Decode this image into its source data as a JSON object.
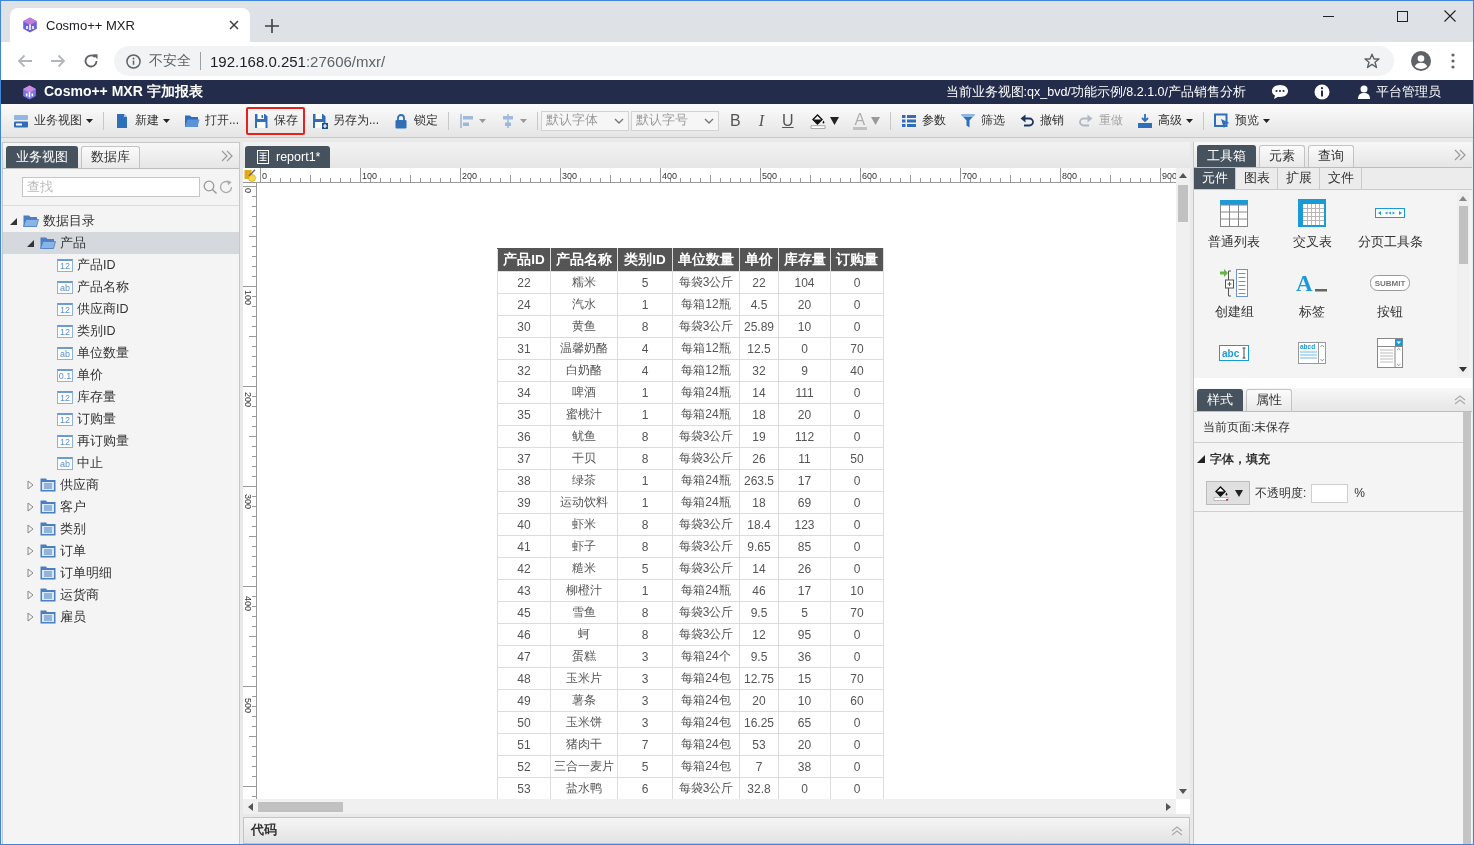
{
  "browser": {
    "tab_title": "Cosmo++ MXR",
    "security_label": "不安全",
    "url_host": "192.168.0.251",
    "url_path": ":27606/mxr/"
  },
  "app_header": {
    "title": "Cosmo++ MXR 宇加报表",
    "current_view": "当前业务视图:qx_bvd/功能示例/8.2.1.0/产品销售分析",
    "user": "平台管理员"
  },
  "toolbar": [
    {
      "kind": "view",
      "label": "业务视图",
      "dropdown": true,
      "disabled": false,
      "highlighted": false
    },
    {
      "kind": "separator"
    },
    {
      "kind": "new",
      "label": "新建",
      "dropdown": true,
      "disabled": false,
      "highlighted": false
    },
    {
      "kind": "open",
      "label": "打开...",
      "dropdown": false,
      "disabled": false,
      "highlighted": false
    },
    {
      "kind": "save",
      "label": "保存",
      "dropdown": false,
      "disabled": false,
      "highlighted": true
    },
    {
      "kind": "save-as",
      "label": "另存为...",
      "dropdown": false,
      "disabled": false,
      "highlighted": false
    },
    {
      "kind": "lock",
      "label": "锁定",
      "dropdown": false,
      "disabled": false,
      "highlighted": false
    },
    {
      "kind": "separator"
    },
    {
      "kind": "align-left",
      "dropdown": true,
      "disabled": true,
      "highlighted": false
    },
    {
      "kind": "align-center",
      "dropdown": true,
      "disabled": true,
      "highlighted": false
    },
    {
      "kind": "separator"
    },
    {
      "kind": "select",
      "value": "默认字体",
      "disabled": true
    },
    {
      "kind": "select",
      "value": "默认字号",
      "disabled": true
    },
    {
      "kind": "bold",
      "glyph": "B",
      "dropdown": false,
      "disabled": false,
      "highlighted": false
    },
    {
      "kind": "italic",
      "glyph": "I",
      "dropdown": false,
      "disabled": false,
      "highlighted": false
    },
    {
      "kind": "underline",
      "glyph": "U",
      "dropdown": false,
      "disabled": false,
      "highlighted": false
    },
    {
      "kind": "fill",
      "dropdown": true,
      "disabled": false,
      "highlighted": false
    },
    {
      "kind": "font-color",
      "glyph": "A",
      "dropdown": true,
      "disabled": true,
      "highlighted": false
    },
    {
      "kind": "separator"
    },
    {
      "kind": "params",
      "label": "参数",
      "dropdown": false,
      "disabled": false,
      "highlighted": false
    },
    {
      "kind": "filter",
      "label": "筛选",
      "dropdown": false,
      "disabled": false,
      "highlighted": false
    },
    {
      "kind": "undo",
      "label": "撤销",
      "dropdown": false,
      "disabled": false,
      "highlighted": false
    },
    {
      "kind": "redo",
      "label": "重做",
      "dropdown": false,
      "disabled": true,
      "highlighted": false
    },
    {
      "kind": "advanced",
      "label": "高级",
      "dropdown": true,
      "disabled": false,
      "highlighted": false
    },
    {
      "kind": "separator"
    },
    {
      "kind": "preview",
      "label": "预览",
      "dropdown": true,
      "disabled": false,
      "highlighted": false
    }
  ],
  "left_panel": {
    "tabs": [
      {
        "label": "业务视图",
        "selected": true
      },
      {
        "label": "数据库",
        "selected": false
      }
    ],
    "search": {
      "placeholder": "查找"
    },
    "tree": [
      {
        "kind": "folder",
        "label": "数据目录",
        "expanded": true,
        "selected": false,
        "children": [
          {
            "kind": "table",
            "label": "产品",
            "expanded": true,
            "selected": true,
            "children": [
              {
                "kind": "field",
                "type": "12",
                "label": "产品ID",
                "selected": false
              },
              {
                "kind": "field",
                "type": "ab",
                "label": "产品名称",
                "selected": false
              },
              {
                "kind": "field",
                "type": "12",
                "label": "供应商ID",
                "selected": false
              },
              {
                "kind": "field",
                "type": "12",
                "label": "类别ID",
                "selected": false
              },
              {
                "kind": "field",
                "type": "ab",
                "label": "单位数量",
                "selected": false
              },
              {
                "kind": "field",
                "type": "0.1",
                "label": "单价",
                "selected": false
              },
              {
                "kind": "field",
                "type": "12",
                "label": "库存量",
                "selected": false
              },
              {
                "kind": "field",
                "type": "12",
                "label": "订购量",
                "selected": false
              },
              {
                "kind": "field",
                "type": "12",
                "label": "再订购量",
                "selected": false
              },
              {
                "kind": "field",
                "type": "ab",
                "label": "中止",
                "selected": false
              }
            ]
          },
          {
            "kind": "table",
            "label": "供应商",
            "expanded": false,
            "selected": false
          },
          {
            "kind": "table",
            "label": "客户",
            "expanded": false,
            "selected": false
          },
          {
            "kind": "table",
            "label": "类别",
            "expanded": false,
            "selected": false
          },
          {
            "kind": "table",
            "label": "订单",
            "expanded": false,
            "selected": false
          },
          {
            "kind": "table",
            "label": "订单明细",
            "expanded": false,
            "selected": false
          },
          {
            "kind": "table",
            "label": "运货商",
            "expanded": false,
            "selected": false
          },
          {
            "kind": "table",
            "label": "雇员",
            "expanded": false,
            "selected": false
          }
        ]
      }
    ]
  },
  "editor": {
    "tabs": [
      {
        "label": "report1*",
        "selected": true
      }
    ],
    "ruler": {
      "horizontal": [
        "0",
        "100",
        "200",
        "300",
        "400",
        "500",
        "600",
        "700",
        "800",
        "900"
      ],
      "vertical": [
        "0",
        "100",
        "200",
        "300",
        "400",
        "500"
      ]
    },
    "table": {
      "columns": [
        "产品ID",
        "产品名称",
        "类别ID",
        "单位数量",
        "单价",
        "库存量",
        "订购量"
      ],
      "rows": [
        [
          "22",
          "糯米",
          "5",
          "每袋3公斤",
          "22",
          "104",
          "0"
        ],
        [
          "24",
          "汽水",
          "1",
          "每箱12瓶",
          "4.5",
          "20",
          "0"
        ],
        [
          "30",
          "黄鱼",
          "8",
          "每袋3公斤",
          "25.89",
          "10",
          "0"
        ],
        [
          "31",
          "温馨奶酪",
          "4",
          "每箱12瓶",
          "12.5",
          "0",
          "70"
        ],
        [
          "32",
          "白奶酪",
          "4",
          "每箱12瓶",
          "32",
          "9",
          "40"
        ],
        [
          "34",
          "啤酒",
          "1",
          "每箱24瓶",
          "14",
          "111",
          "0"
        ],
        [
          "35",
          "蜜桃汁",
          "1",
          "每箱24瓶",
          "18",
          "20",
          "0"
        ],
        [
          "36",
          "鱿鱼",
          "8",
          "每袋3公斤",
          "19",
          "112",
          "0"
        ],
        [
          "37",
          "干贝",
          "8",
          "每袋3公斤",
          "26",
          "11",
          "50"
        ],
        [
          "38",
          "绿茶",
          "1",
          "每箱24瓶",
          "263.5",
          "17",
          "0"
        ],
        [
          "39",
          "运动饮料",
          "1",
          "每箱24瓶",
          "18",
          "69",
          "0"
        ],
        [
          "40",
          "虾米",
          "8",
          "每袋3公斤",
          "18.4",
          "123",
          "0"
        ],
        [
          "41",
          "虾子",
          "8",
          "每袋3公斤",
          "9.65",
          "85",
          "0"
        ],
        [
          "42",
          "糙米",
          "5",
          "每袋3公斤",
          "14",
          "26",
          "0"
        ],
        [
          "43",
          "柳橙汁",
          "1",
          "每箱24瓶",
          "46",
          "17",
          "10"
        ],
        [
          "45",
          "雪鱼",
          "8",
          "每袋3公斤",
          "9.5",
          "5",
          "70"
        ],
        [
          "46",
          "蚵",
          "8",
          "每袋3公斤",
          "12",
          "95",
          "0"
        ],
        [
          "47",
          "蛋糕",
          "3",
          "每箱24个",
          "9.5",
          "36",
          "0"
        ],
        [
          "48",
          "玉米片",
          "3",
          "每箱24包",
          "12.75",
          "15",
          "70"
        ],
        [
          "49",
          "薯条",
          "3",
          "每箱24包",
          "20",
          "10",
          "60"
        ],
        [
          "50",
          "玉米饼",
          "3",
          "每箱24包",
          "16.25",
          "65",
          "0"
        ],
        [
          "51",
          "猪肉干",
          "7",
          "每箱24包",
          "53",
          "20",
          "0"
        ],
        [
          "52",
          "三合一麦片",
          "5",
          "每箱24包",
          "7",
          "38",
          "0"
        ],
        [
          "53",
          "盐水鸭",
          "6",
          "每袋3公斤",
          "32.8",
          "0",
          "0"
        ]
      ]
    },
    "bottom_panel": {
      "title": "代码"
    }
  },
  "right_panel": {
    "tabs": [
      {
        "label": "工具箱",
        "selected": true
      },
      {
        "label": "元素",
        "selected": false
      },
      {
        "label": "查询",
        "selected": false
      }
    ],
    "subtabs": [
      {
        "label": "元件",
        "selected": true
      },
      {
        "label": "图表",
        "selected": false
      },
      {
        "label": "扩展",
        "selected": false
      },
      {
        "label": "文件",
        "selected": false
      }
    ],
    "components": [
      {
        "kind": "list",
        "label": "普通列表"
      },
      {
        "kind": "crosstab",
        "label": "交叉表"
      },
      {
        "kind": "pager",
        "label": "分页工具条"
      },
      {
        "kind": "group",
        "label": "创建组"
      },
      {
        "kind": "label",
        "label": "标签",
        "glyph": "A"
      },
      {
        "kind": "button",
        "label": "按钮",
        "glyph": "SUBMIT"
      },
      {
        "kind": "textbox",
        "glyph": "abc"
      },
      {
        "kind": "textarea",
        "glyph": "abcd"
      },
      {
        "kind": "dropdown"
      }
    ]
  },
  "style_panel": {
    "tabs": [
      {
        "label": "样式",
        "selected": true
      },
      {
        "label": "属性",
        "selected": false
      }
    ],
    "page_status": "当前页面:未保存",
    "section": {
      "title": "字体，填充",
      "expanded": true
    },
    "opacity": {
      "label": "不透明度:",
      "unit": "%"
    }
  }
}
